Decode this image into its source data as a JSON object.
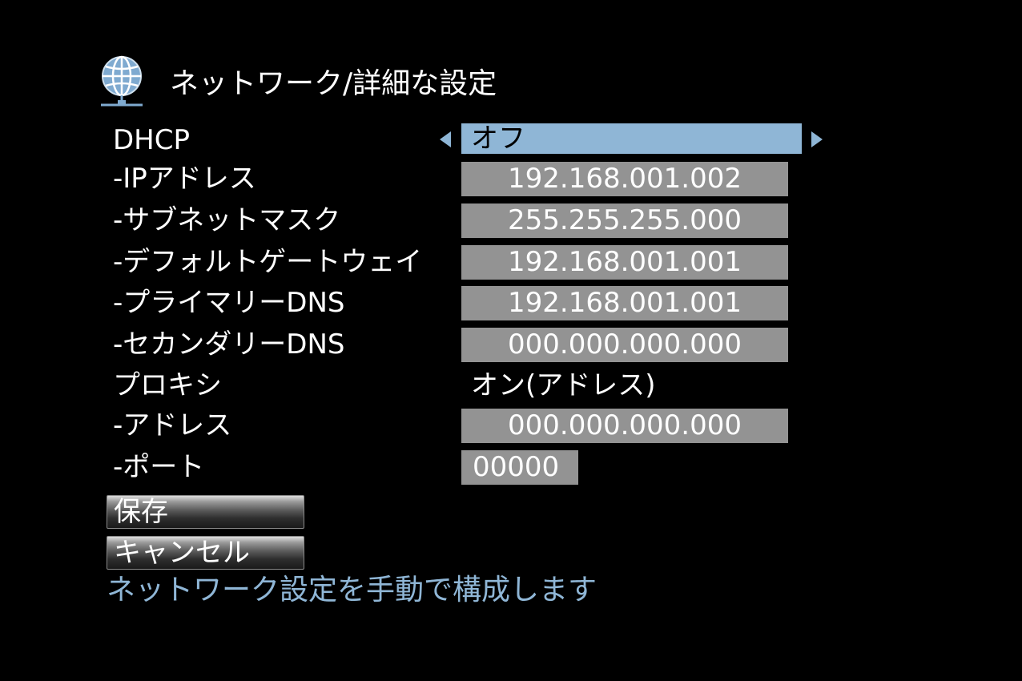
{
  "header": {
    "title": "ネットワーク/詳細な設定",
    "icon": "globe-network-icon"
  },
  "settings": {
    "dhcp": {
      "label": "DHCP",
      "value": "オフ"
    },
    "ip_address": {
      "label": "-IPアドレス",
      "value": "192.168.001.002"
    },
    "subnet_mask": {
      "label": "-サブネットマスク",
      "value": "255.255.255.000"
    },
    "default_gateway": {
      "label": "-デフォルトゲートウェイ",
      "value": "192.168.001.001"
    },
    "primary_dns": {
      "label": "-プライマリーDNS",
      "value": "192.168.001.001"
    },
    "secondary_dns": {
      "label": "-セカンダリーDNS",
      "value": "000.000.000.000"
    },
    "proxy": {
      "label": "プロキシ",
      "value": "オン(アドレス)"
    },
    "proxy_address": {
      "label": "-アドレス",
      "value": "000.000.000.000"
    },
    "proxy_port": {
      "label": "-ポート",
      "value": "00000"
    }
  },
  "buttons": {
    "save_label": "保存",
    "cancel_label": "キャンセル"
  },
  "help_text": "ネットワーク設定を手動で構成します",
  "colors": {
    "background": "#000000",
    "highlight": "#8fb6d6",
    "field": "#939393",
    "text": "#ffffff"
  }
}
